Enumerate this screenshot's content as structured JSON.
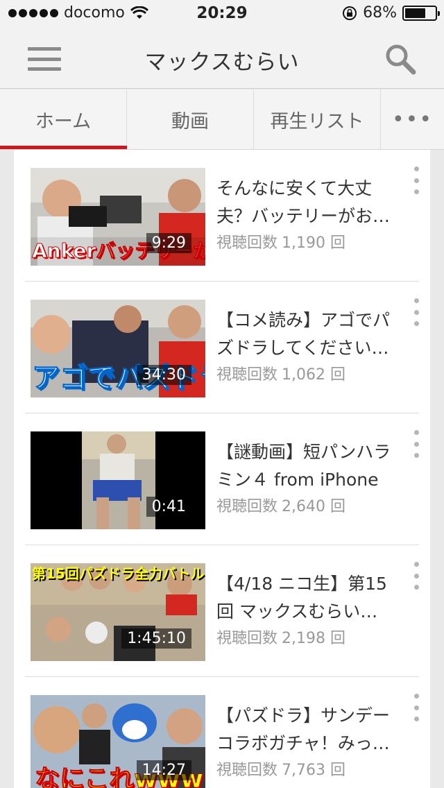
{
  "status": {
    "carrier": "docomo",
    "time": "20:29",
    "battery": "68%",
    "battery_level": 0.68
  },
  "header": {
    "title": "マックスむらい"
  },
  "tabs": [
    {
      "label": "ホーム",
      "active": true
    },
    {
      "label": "動画"
    },
    {
      "label": "再生リスト"
    },
    {
      "label": "•••"
    }
  ],
  "videos": [
    {
      "title_line1": "そんなに安くて大丈",
      "title_line2": "夫？バッテリーがお…",
      "views_label": "視聴回数",
      "views": "1,190 回",
      "duration": "9:29",
      "caption": "Ankerバッテリーが安い!"
    },
    {
      "title_line1": "【コメ読み】アゴでパ",
      "title_line2": "ズドラしてください…",
      "views_label": "視聴回数",
      "views": "1,062 回",
      "duration": "34:30",
      "caption": "アゴでパズドラ"
    },
    {
      "title_line1": "【謎動画】短パンハラ",
      "title_line2": "ミン４ from iPhone",
      "views_label": "視聴回数",
      "views": "2,640 回",
      "duration": "0:41",
      "caption": ""
    },
    {
      "title_line1": "【4/18 ニコ生】第15",
      "title_line2": "回 マックスむらい…",
      "views_label": "視聴回数",
      "views": "2,198 回",
      "duration": "1:45:10",
      "caption": "第15回パズドラ全力バトル"
    },
    {
      "title_line1": "【パズドラ】サンデー",
      "title_line2": "コラボガチャ！みっ…",
      "views_label": "視聴回数",
      "views": "7,763 回",
      "duration": "14:27",
      "caption": "なにこれwww"
    }
  ]
}
